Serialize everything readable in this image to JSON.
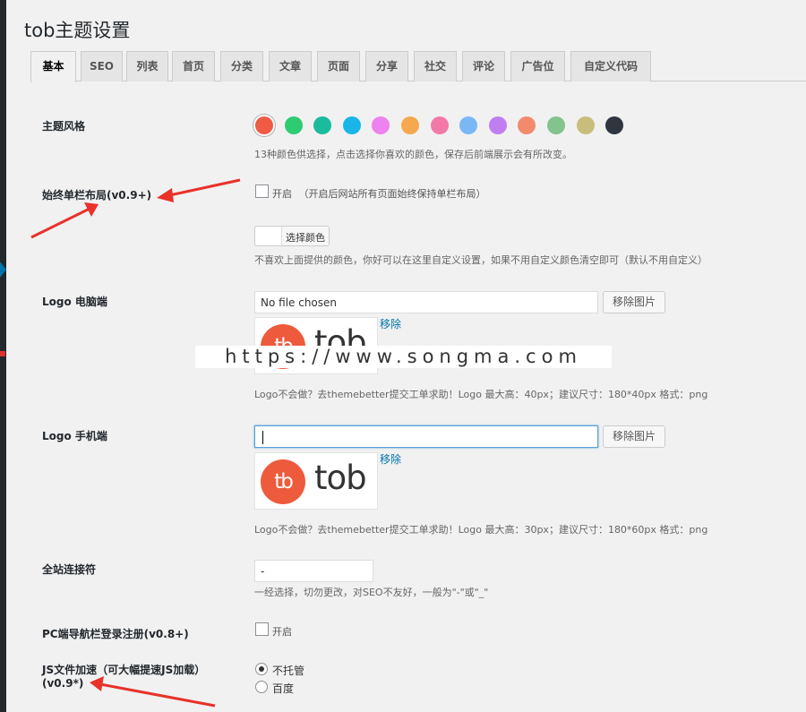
{
  "page": {
    "title": "tob主题设置"
  },
  "tabs": [
    {
      "label": "基本",
      "active": true
    },
    {
      "label": "SEO"
    },
    {
      "label": "列表"
    },
    {
      "label": "首页"
    },
    {
      "label": "分类"
    },
    {
      "label": "文章"
    },
    {
      "label": "页面"
    },
    {
      "label": "分享"
    },
    {
      "label": "社交"
    },
    {
      "label": "评论"
    },
    {
      "label": "广告位"
    },
    {
      "label": "自定义代码"
    }
  ],
  "theme_style": {
    "label": "主题风格",
    "colors": [
      "#ef5b45",
      "#2ecc71",
      "#1abc9c",
      "#1ab5e8",
      "#ee82ee",
      "#f6a84f",
      "#f37aa8",
      "#7ab8f5",
      "#c17ef0",
      "#f38a6e",
      "#82c38e",
      "#c8bd7a",
      "#2f3640"
    ],
    "selected_index": 0,
    "description": "13种颜色供选择，点击选择你喜欢的颜色，保存后前端展示会有所改变。"
  },
  "single_column": {
    "label": "始终单栏布局(v0.9+)",
    "checkbox_label": "开启",
    "checkbox_note": "（开启后网站所有页面始终保持单栏布局）",
    "checked": false
  },
  "custom_color": {
    "button_label": "选择颜色",
    "description": "不喜欢上面提供的颜色，你好可以在这里自定义设置，如果不用自定义颜色清空即可（默认不用自定义）"
  },
  "logo_desktop": {
    "label": "Logo 电脑端",
    "input_value": "No file chosen",
    "remove_button": "移除图片",
    "remove_link": "移除",
    "logo_mark": "tb",
    "logo_word": "tob",
    "description": "Logo不会做？去themebetter提交工单求助！Logo 最大高：40px；建议尺寸：180*40px 格式：png"
  },
  "logo_mobile": {
    "label": "Logo 手机端",
    "input_value": "",
    "remove_button": "移除图片",
    "remove_link": "移除",
    "logo_mark": "tb",
    "logo_word": "tob",
    "description": "Logo不会做？去themebetter提交工单求助！Logo 最大高：30px；建议尺寸：180*60px 格式：png"
  },
  "connector": {
    "label": "全站连接符",
    "input_value": "-",
    "description": "一经选择，切勿更改，对SEO不友好，一般为\"-\"或\"_\""
  },
  "pc_nav_login": {
    "label": "PC端导航栏登录注册(v0.8+)",
    "checkbox_label": "开启",
    "checked": false
  },
  "js_accel": {
    "label_line1": "JS文件加速（可大幅提速JS加载）",
    "label_line2": "(v0.9*)",
    "options": [
      {
        "label": "不托管",
        "selected": true
      },
      {
        "label": "百度",
        "selected": false
      }
    ]
  },
  "watermark": {
    "text": "https://www.songma.com"
  },
  "annotation_color": "#e8322a"
}
